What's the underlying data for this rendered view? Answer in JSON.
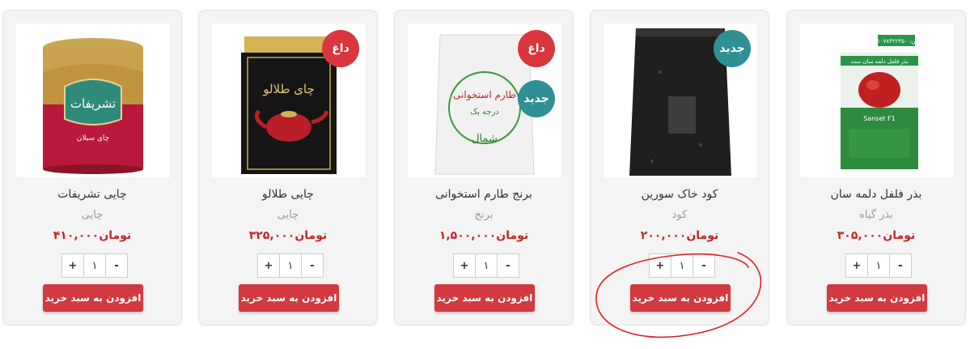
{
  "products": [
    {
      "title": "چایی تشریفات",
      "category": "چایی",
      "price": "تومان۴۱۰,۰۰۰",
      "qty": "۱",
      "add_label": "افزودن به سبد خرید",
      "badges": [],
      "package_text": "تشریفات",
      "package_subtext": "چای سیلان"
    },
    {
      "title": "چایی طلالو",
      "category": "چایی",
      "price": "تومان۳۲۵,۰۰۰",
      "qty": "۱",
      "add_label": "افزودن به سبد خرید",
      "badges": [
        "داغ"
      ],
      "package_text": "چای طلالو"
    },
    {
      "title": "برنج طارم استخوانی",
      "category": "برنج",
      "price": "تومان۱,۵۰۰,۰۰۰",
      "qty": "۱",
      "add_label": "افزودن به سبد خرید",
      "badges": [
        "داغ",
        "جدید"
      ],
      "package_text": "طارم استخوانی",
      "package_subtext": "درجه یک",
      "package_subtext2": "شمال"
    },
    {
      "title": "کود خاک سورین",
      "category": "کود",
      "price": "تومان۲۰۰,۰۰۰",
      "qty": "۱",
      "add_label": "افزودن به سبد خرید",
      "badges": [
        "جدید"
      ]
    },
    {
      "title": "بذر فلفل دلمه سان",
      "category": "بذر گیاه",
      "price": "تومان۳۰۵,۰۰۰",
      "qty": "۱",
      "add_label": "افزودن به سبد خرید",
      "badges": [],
      "package_text": "بذر فلفل دلمه سان ست",
      "package_subtext": "Sanset F1",
      "package_phone": "تلفن: ۰۹۱۰۷۸۴۲۲۳۵۰"
    }
  ],
  "colors": {
    "hot_badge": "#d9363e",
    "new_badge": "#2e8f95",
    "add_button": "#d23a40",
    "price": "#c62828",
    "annotation": "#e02020"
  }
}
